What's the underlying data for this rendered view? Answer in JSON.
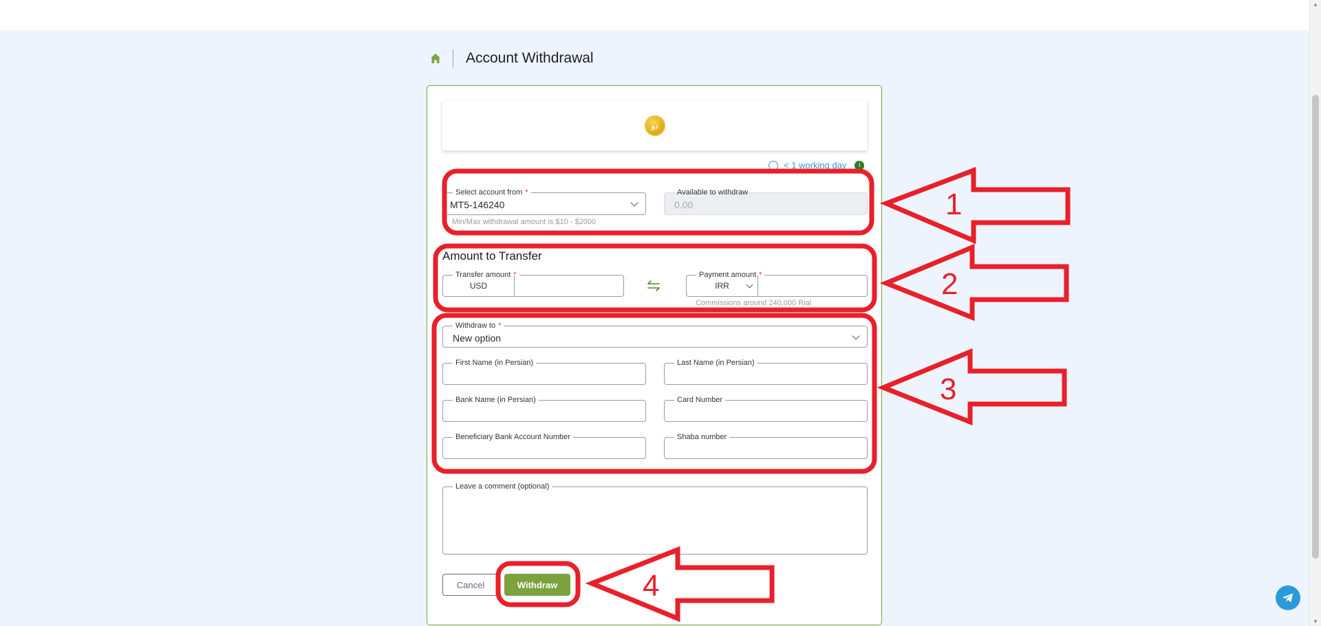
{
  "breadcrumb": {
    "title": "Account Withdrawal",
    "home_icon": "home-icon"
  },
  "colors": {
    "accent": "#7ba23f",
    "annotation": "#e8202a",
    "link": "#3b8fd6"
  },
  "eta": {
    "text": "< 1 working day",
    "info": "i"
  },
  "logo": {
    "glyph": "ﺩﻭ"
  },
  "account": {
    "label": "Select account from",
    "value": "MT5-146240",
    "hint": "Min/Max withdrawal amount is $10 - $2000"
  },
  "available": {
    "label": "Available to withdraw",
    "value": "0.00"
  },
  "amount_section": {
    "title": "Amount to Transfer"
  },
  "transfer": {
    "label": "Transfer amount",
    "currency": "USD",
    "value": ""
  },
  "payment": {
    "label": "Payment amount",
    "currency": "IRR",
    "value": "",
    "hint": "Commissions around 240,000 Rial"
  },
  "withdraw_to": {
    "label": "Withdraw to",
    "value": "New option"
  },
  "fields": {
    "first_name": "First Name (in Persian)",
    "last_name": "Last Name (in Persian)",
    "bank_name": "Bank Name (in Persian)",
    "card_number": "Card Number",
    "account_number": "Beneficiary Bank Account Number",
    "shaba": "Shaba number",
    "comment": "Leave a comment (optional)"
  },
  "buttons": {
    "cancel": "Cancel",
    "withdraw": "Withdraw"
  },
  "annotations": [
    "1",
    "2",
    "3",
    "4"
  ]
}
